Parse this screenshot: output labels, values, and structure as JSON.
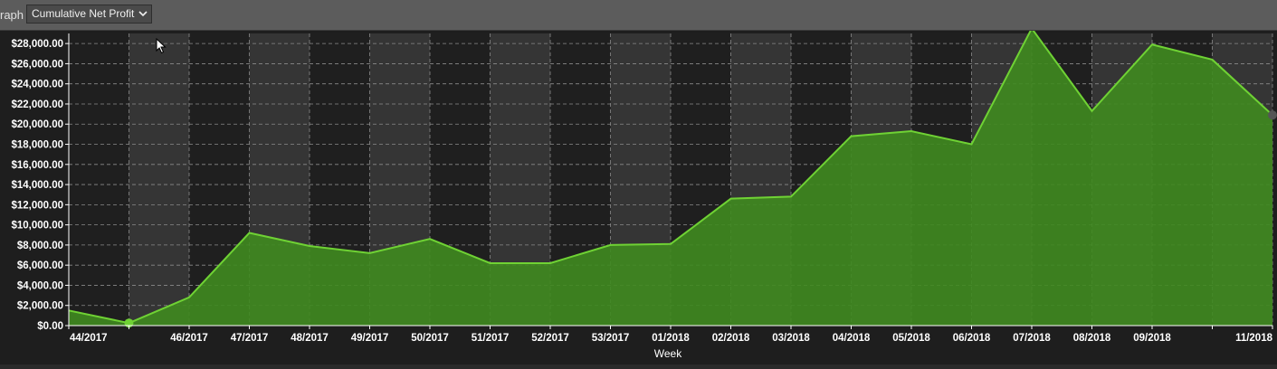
{
  "toolbar": {
    "graph_label": "raph",
    "selected_graph": "Cumulative Net Profit"
  },
  "colors": {
    "area_fill": "#3f8a1f",
    "line": "#6fd234",
    "band_light": "#353535",
    "band_dark": "#1f1f1f",
    "grid": "#8a8a8a",
    "text": "#ffffff"
  },
  "chart_data": {
    "type": "area",
    "xlabel": "Week",
    "ylabel": "",
    "ylim": [
      0,
      29000
    ],
    "yticks": [
      "$0.00",
      "$2,000.00",
      "$4,000.00",
      "$6,000.00",
      "$8,000.00",
      "$10,000.00",
      "$12,000.00",
      "$14,000.00",
      "$16,000.00",
      "$18,000.00",
      "$20,000.00",
      "$22,000.00",
      "$24,000.00",
      "$26,000.00",
      "$28,000.00"
    ],
    "ytick_values": [
      0,
      2000,
      4000,
      6000,
      8000,
      10000,
      12000,
      14000,
      16000,
      18000,
      20000,
      22000,
      24000,
      26000,
      28000
    ],
    "xtick_labels": [
      "44/2017",
      "",
      "46/2017",
      "47/2017",
      "48/2017",
      "49/2017",
      "50/2017",
      "51/2017",
      "52/2017",
      "53/2017",
      "01/2018",
      "02/2018",
      "03/2018",
      "04/2018",
      "05/2018",
      "06/2018",
      "07/2018",
      "08/2018",
      "09/2018",
      "",
      "11/2018"
    ],
    "values": [
      1500,
      250,
      2800,
      9200,
      7900,
      7200,
      8600,
      6200,
      6200,
      8000,
      8100,
      12600,
      12800,
      18800,
      19300,
      18000,
      29500,
      21300,
      27900,
      26400,
      20900
    ],
    "grid": true,
    "legend": "none"
  }
}
